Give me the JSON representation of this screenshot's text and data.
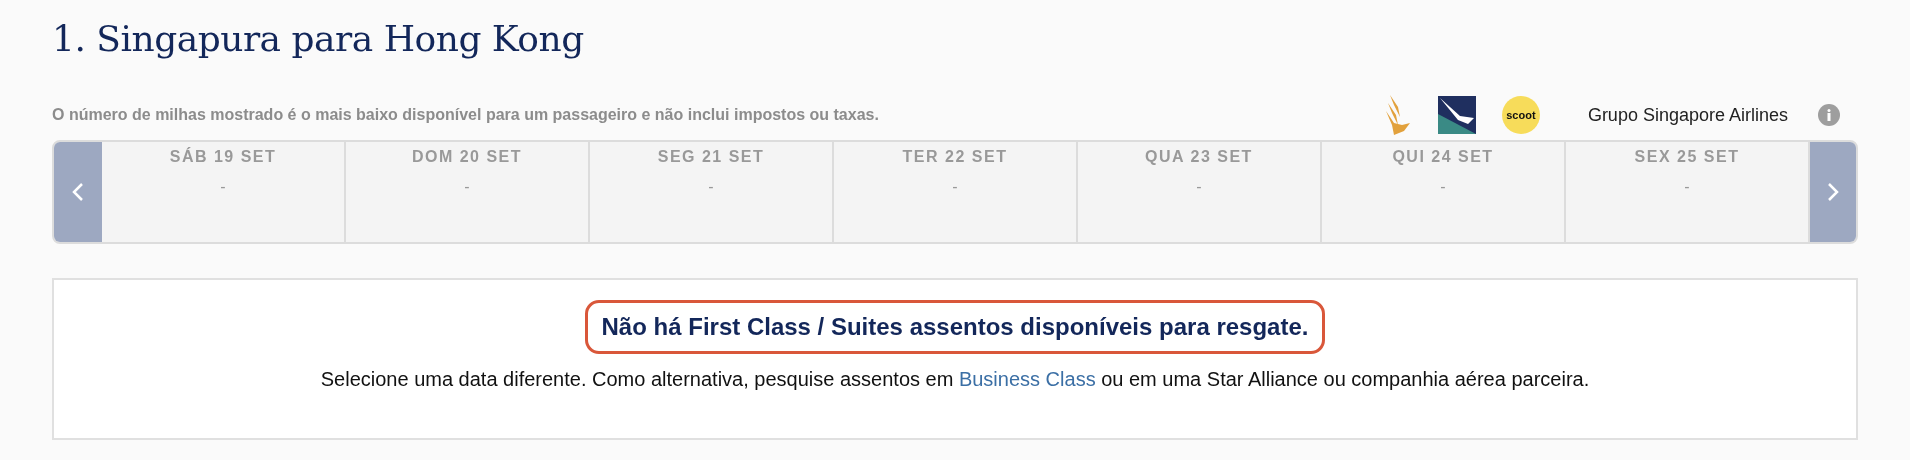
{
  "title": "1. Singapura para Hong Kong",
  "disclaimer": "O número de milhas mostrado é o mais baixo disponível para um passageiro e não inclui impostos ou taxas.",
  "airline_group": {
    "logos": [
      {
        "kind": "bird"
      },
      {
        "kind": "albatross"
      },
      {
        "kind": "badge",
        "text": "scoot"
      }
    ],
    "label": "Grupo Singapore Airlines"
  },
  "dates": [
    {
      "label": "SÁB 19 SET",
      "value": "-"
    },
    {
      "label": "DOM 20 SET",
      "value": "-"
    },
    {
      "label": "SEG 21 SET",
      "value": "-"
    },
    {
      "label": "TER 22 SET",
      "value": "-"
    },
    {
      "label": "QUA 23 SET",
      "value": "-"
    },
    {
      "label": "QUI 24 SET",
      "value": "-"
    },
    {
      "label": "SEX 25 SET",
      "value": "-"
    }
  ],
  "message": {
    "headline": "Não há First Class / Suites assentos disponíveis para resgate.",
    "text_before": "Selecione uma data diferente. Como alternativa, pesquise assentos em ",
    "link": "Business Class",
    "text_after": " ou em uma Star Alliance ou companhia aérea parceira."
  }
}
